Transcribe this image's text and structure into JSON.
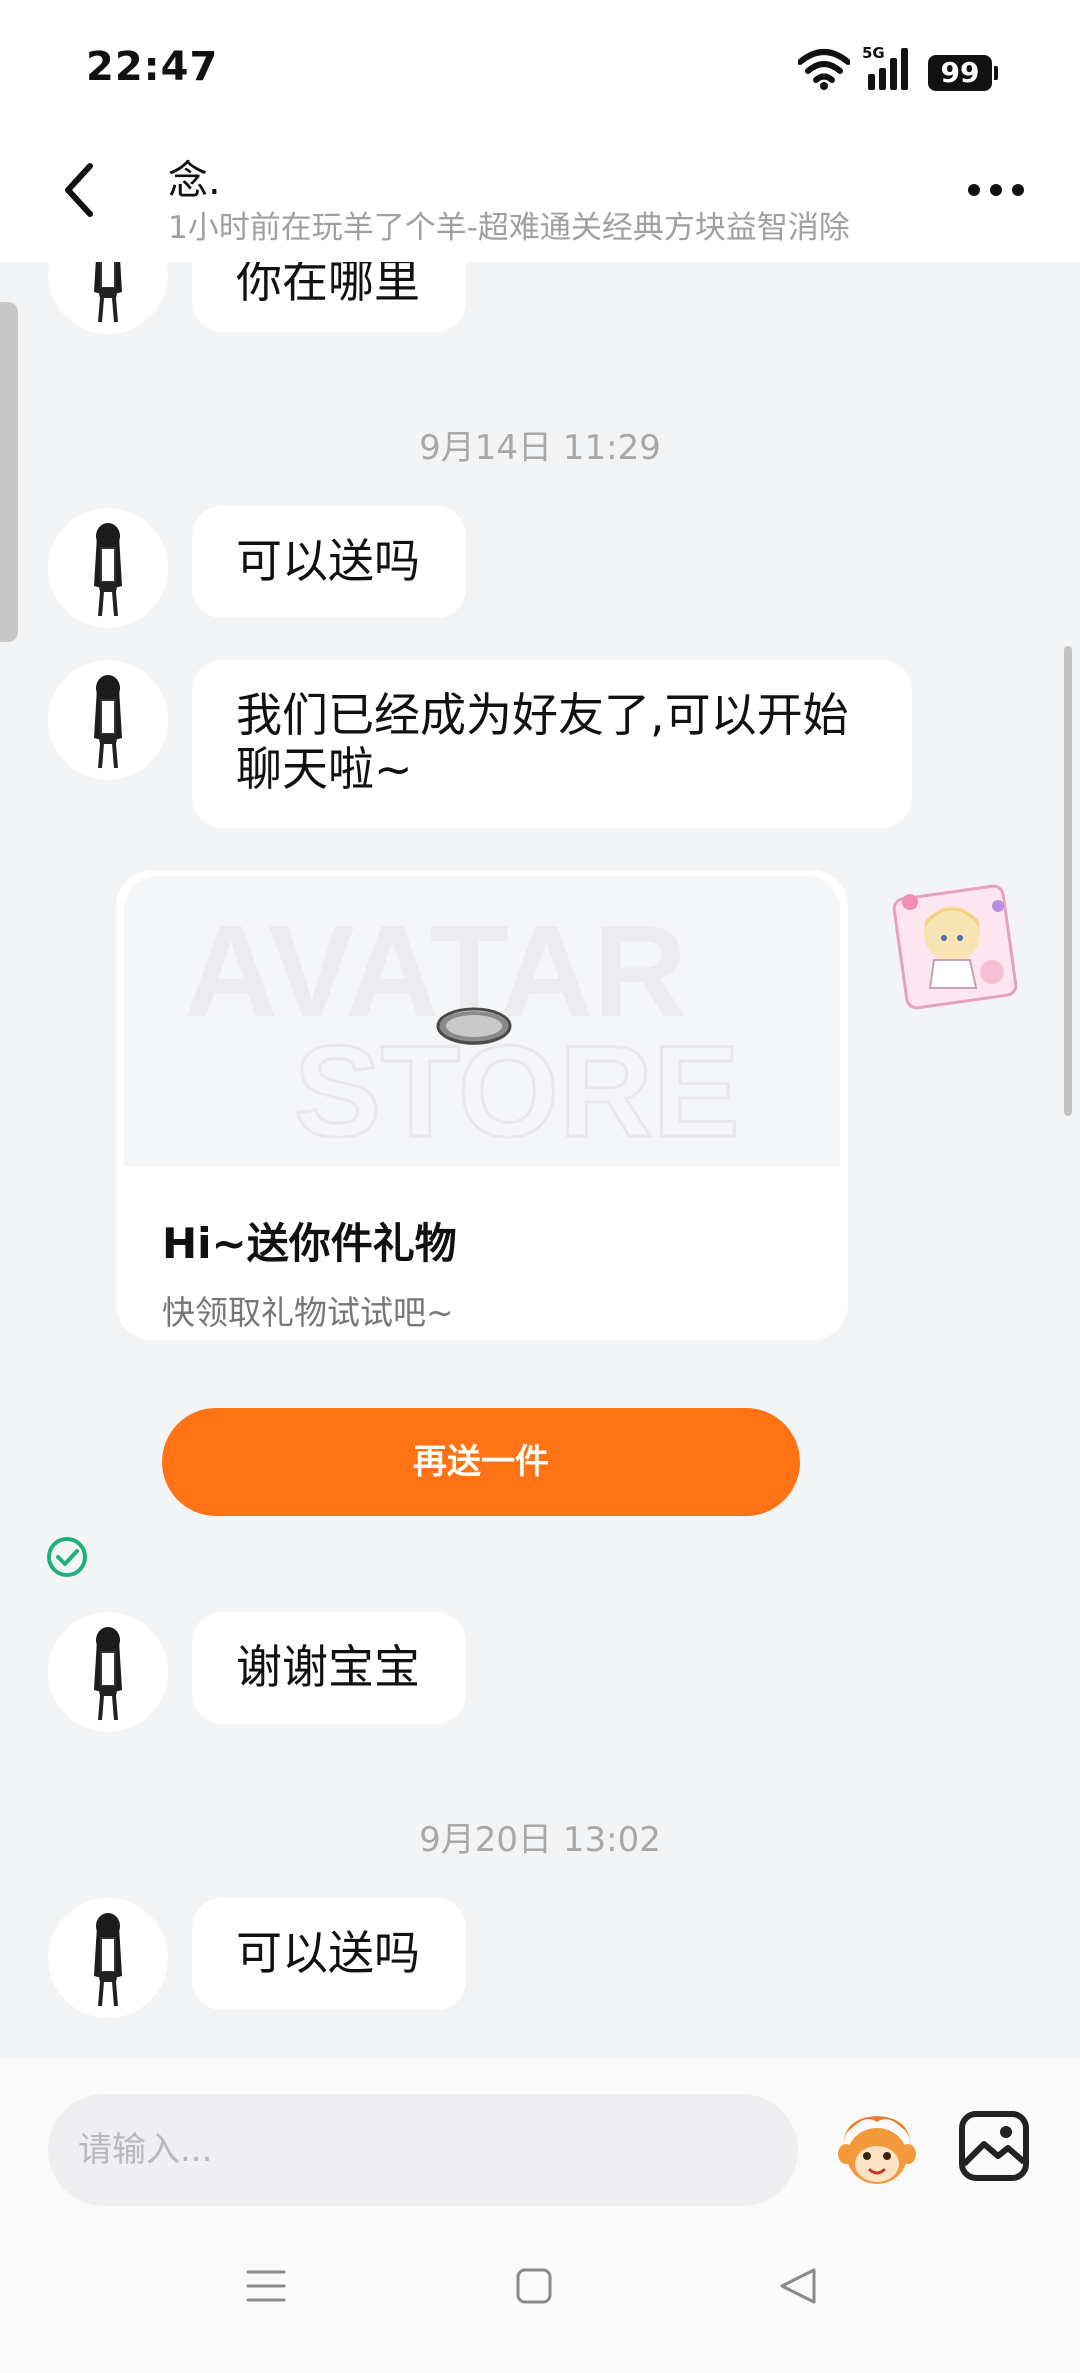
{
  "status_bar": {
    "time": "22:47",
    "network": "5G",
    "battery": "99"
  },
  "header": {
    "title": "念.",
    "subtitle": "1小时前在玩羊了个羊-超难通关经典方块益智消除"
  },
  "messages": [
    {
      "type": "text",
      "from": "other",
      "text": "你在哪里"
    },
    {
      "type": "timestamp",
      "text": "9月14日 11:29"
    },
    {
      "type": "text",
      "from": "other",
      "text": "可以送吗"
    },
    {
      "type": "text",
      "from": "other",
      "lines": [
        "我们已经成为好友了,可以开始",
        "聊天啦~"
      ]
    },
    {
      "type": "gift_card",
      "from": "me",
      "watermark_top": "AVATAR",
      "watermark_bottom": "STORE",
      "title": "Hi~送你件礼物",
      "subtitle": "快领取礼物试试吧~",
      "button": "再送一件",
      "status": "read"
    },
    {
      "type": "text",
      "from": "other",
      "text": "谢谢宝宝"
    },
    {
      "type": "timestamp",
      "text": "9月20日 13:02"
    },
    {
      "type": "text",
      "from": "other",
      "text": "可以送吗"
    }
  ],
  "input": {
    "placeholder": "请输入..."
  },
  "icons": {
    "back": "back-icon",
    "more": "more-icon",
    "sticker": "sticker-icon",
    "image": "image-icon",
    "read": "check-icon"
  },
  "colors": {
    "accent": "#ff7314",
    "read_check": "#1fb07a"
  }
}
